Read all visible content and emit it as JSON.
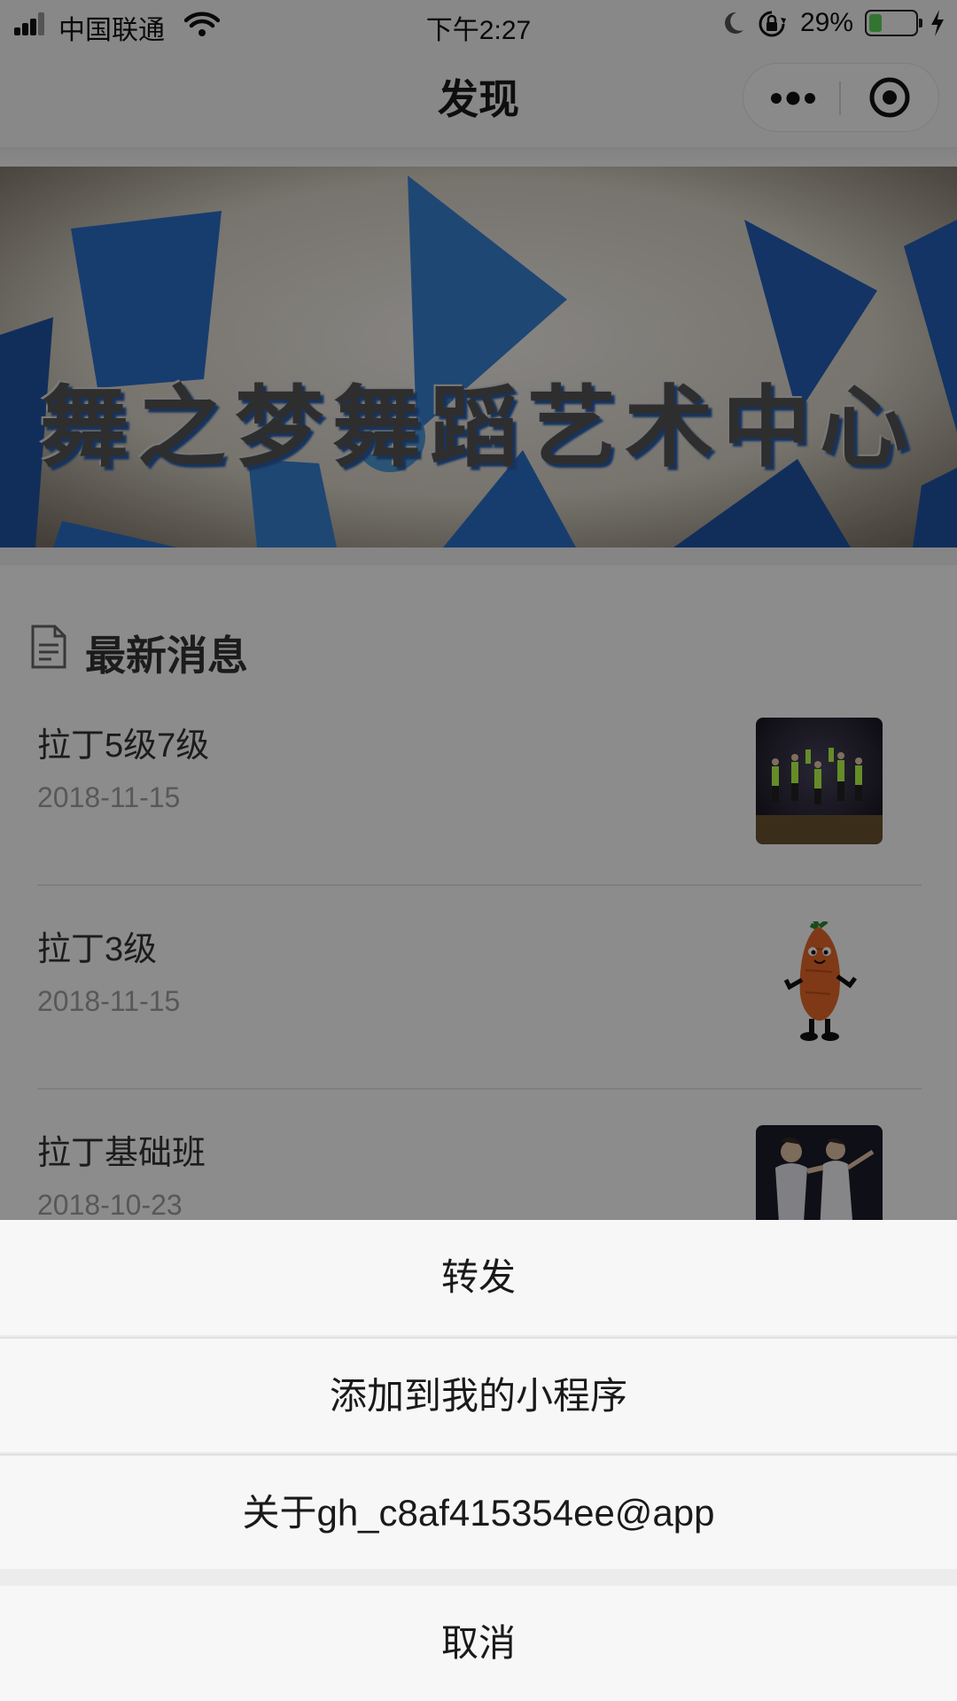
{
  "status_bar": {
    "carrier": "中国联通",
    "time": "下午2:27",
    "battery_percent": "29%",
    "battery_level": 0.29
  },
  "nav": {
    "title": "发现"
  },
  "banner": {
    "text": "舞之梦舞蹈艺术中心"
  },
  "news": {
    "section_title": "最新消息",
    "items": [
      {
        "title": "拉丁5级7级",
        "date": "2018-11-15",
        "thumb": "dance-group-photo"
      },
      {
        "title": "拉丁3级",
        "date": "2018-11-15",
        "thumb": "carrot-mascot"
      },
      {
        "title": "拉丁基础班",
        "date": "2018-10-23",
        "thumb": "dance-pair-photo"
      }
    ]
  },
  "action_sheet": {
    "items": [
      {
        "label": "转发"
      },
      {
        "label": "添加到我的小程序"
      },
      {
        "label": "关于gh_c8af415354ee@app"
      }
    ],
    "cancel_label": "取消"
  },
  "colors": {
    "banner_blue": "#2a6fc9",
    "battery_green": "#5ad65a",
    "mask": "rgba(0,0,0,0.45)"
  }
}
